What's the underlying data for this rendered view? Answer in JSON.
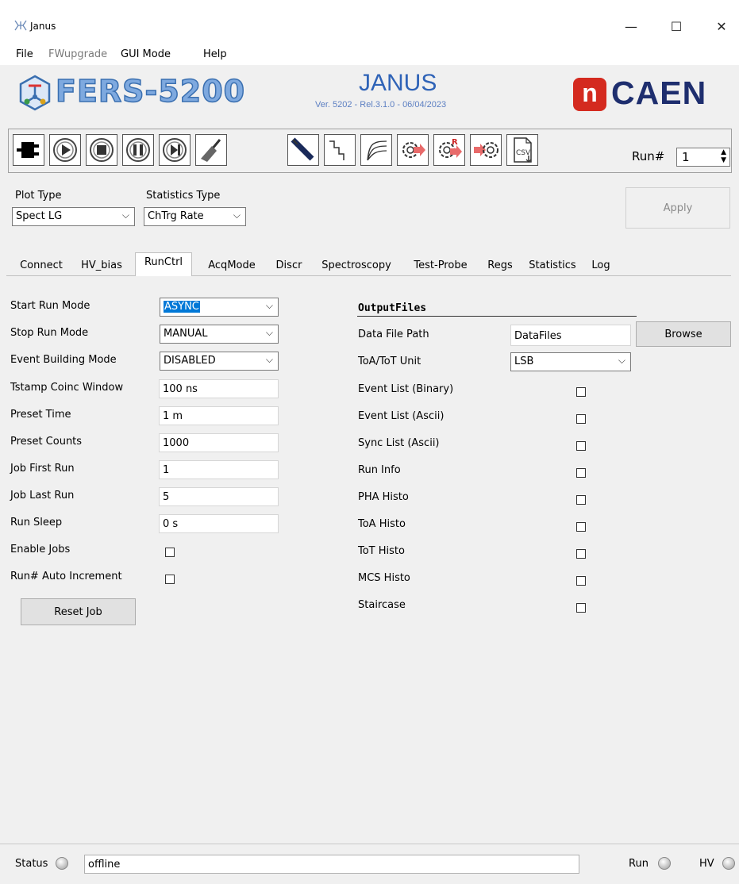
{
  "window": {
    "title": "Janus",
    "controls": {
      "minimize": "—",
      "maximize": "☐",
      "close": "✕"
    }
  },
  "menu": [
    "File",
    "FWupgrade",
    "GUI Mode",
    "Help"
  ],
  "banner": {
    "product": "FERS-5200",
    "app_name": "JANUS",
    "version": "Ver. 5202 - Rel.3.1.0 - 06/04/2023",
    "brand": "CAEN",
    "brand_mark": "n",
    "brand_color": "#1e2e6e",
    "mark_color": "#d42a1f"
  },
  "toolbar": {
    "icons": [
      "plug-icon",
      "play-icon",
      "stop-icon",
      "pause-icon",
      "step-icon",
      "broom-icon",
      "probe-icon",
      "step-line-icon",
      "curves-icon",
      "gear-arrow-icon",
      "gear-r-icon",
      "gear-arrow-right-icon",
      "csv-icon"
    ],
    "csv_text": "CSV",
    "gear_r_text": "R",
    "run_label": "Run#",
    "run_value": "1"
  },
  "plot": {
    "plot_type_label": "Plot Type",
    "plot_type_value": "Spect LG",
    "stats_type_label": "Statistics Type",
    "stats_type_value": "ChTrg Rate",
    "apply_label": "Apply"
  },
  "tabs": [
    "Connect",
    "HV_bias",
    "RunCtrl",
    "AcqMode",
    "Discr",
    "Spectroscopy",
    "Test-Probe",
    "Regs",
    "Statistics",
    "Log"
  ],
  "active_tab": "RunCtrl",
  "runctrl": {
    "start_run_mode_label": "Start Run Mode",
    "start_run_mode_value": "ASYNC",
    "stop_run_mode_label": "Stop Run Mode",
    "stop_run_mode_value": "MANUAL",
    "event_building_label": "Event Building Mode",
    "event_building_value": "DISABLED",
    "tstamp_label": "Tstamp Coinc Window",
    "tstamp_value": "100 ns",
    "preset_time_label": "Preset Time",
    "preset_time_value": "1 m",
    "preset_counts_label": "Preset Counts",
    "preset_counts_value": "1000",
    "job_first_label": "Job First Run",
    "job_first_value": "1",
    "job_last_label": "Job Last Run",
    "job_last_value": "5",
    "run_sleep_label": "Run Sleep",
    "run_sleep_value": "0 s",
    "enable_jobs_label": "Enable Jobs",
    "enable_jobs_checked": false,
    "auto_inc_label": "Run# Auto Increment",
    "auto_inc_checked": false,
    "reset_job_label": "Reset Job"
  },
  "output": {
    "header": "OutputFiles",
    "data_path_label": "Data File Path",
    "data_path_value": "DataFiles",
    "browse_label": "Browse",
    "unit_label": "ToA/ToT Unit",
    "unit_value": "LSB",
    "files": [
      {
        "label": "Event List (Binary)",
        "checked": false
      },
      {
        "label": "Event List (Ascii)",
        "checked": false
      },
      {
        "label": "Sync List (Ascii)",
        "checked": false
      },
      {
        "label": "Run Info",
        "checked": false
      },
      {
        "label": "PHA Histo",
        "checked": false
      },
      {
        "label": "ToA Histo",
        "checked": false
      },
      {
        "label": "ToT Histo",
        "checked": false
      },
      {
        "label": "MCS Histo",
        "checked": false
      },
      {
        "label": "Staircase",
        "checked": false
      }
    ]
  },
  "status": {
    "label": "Status",
    "value": "offline",
    "run_label": "Run",
    "hv_label": "HV"
  }
}
